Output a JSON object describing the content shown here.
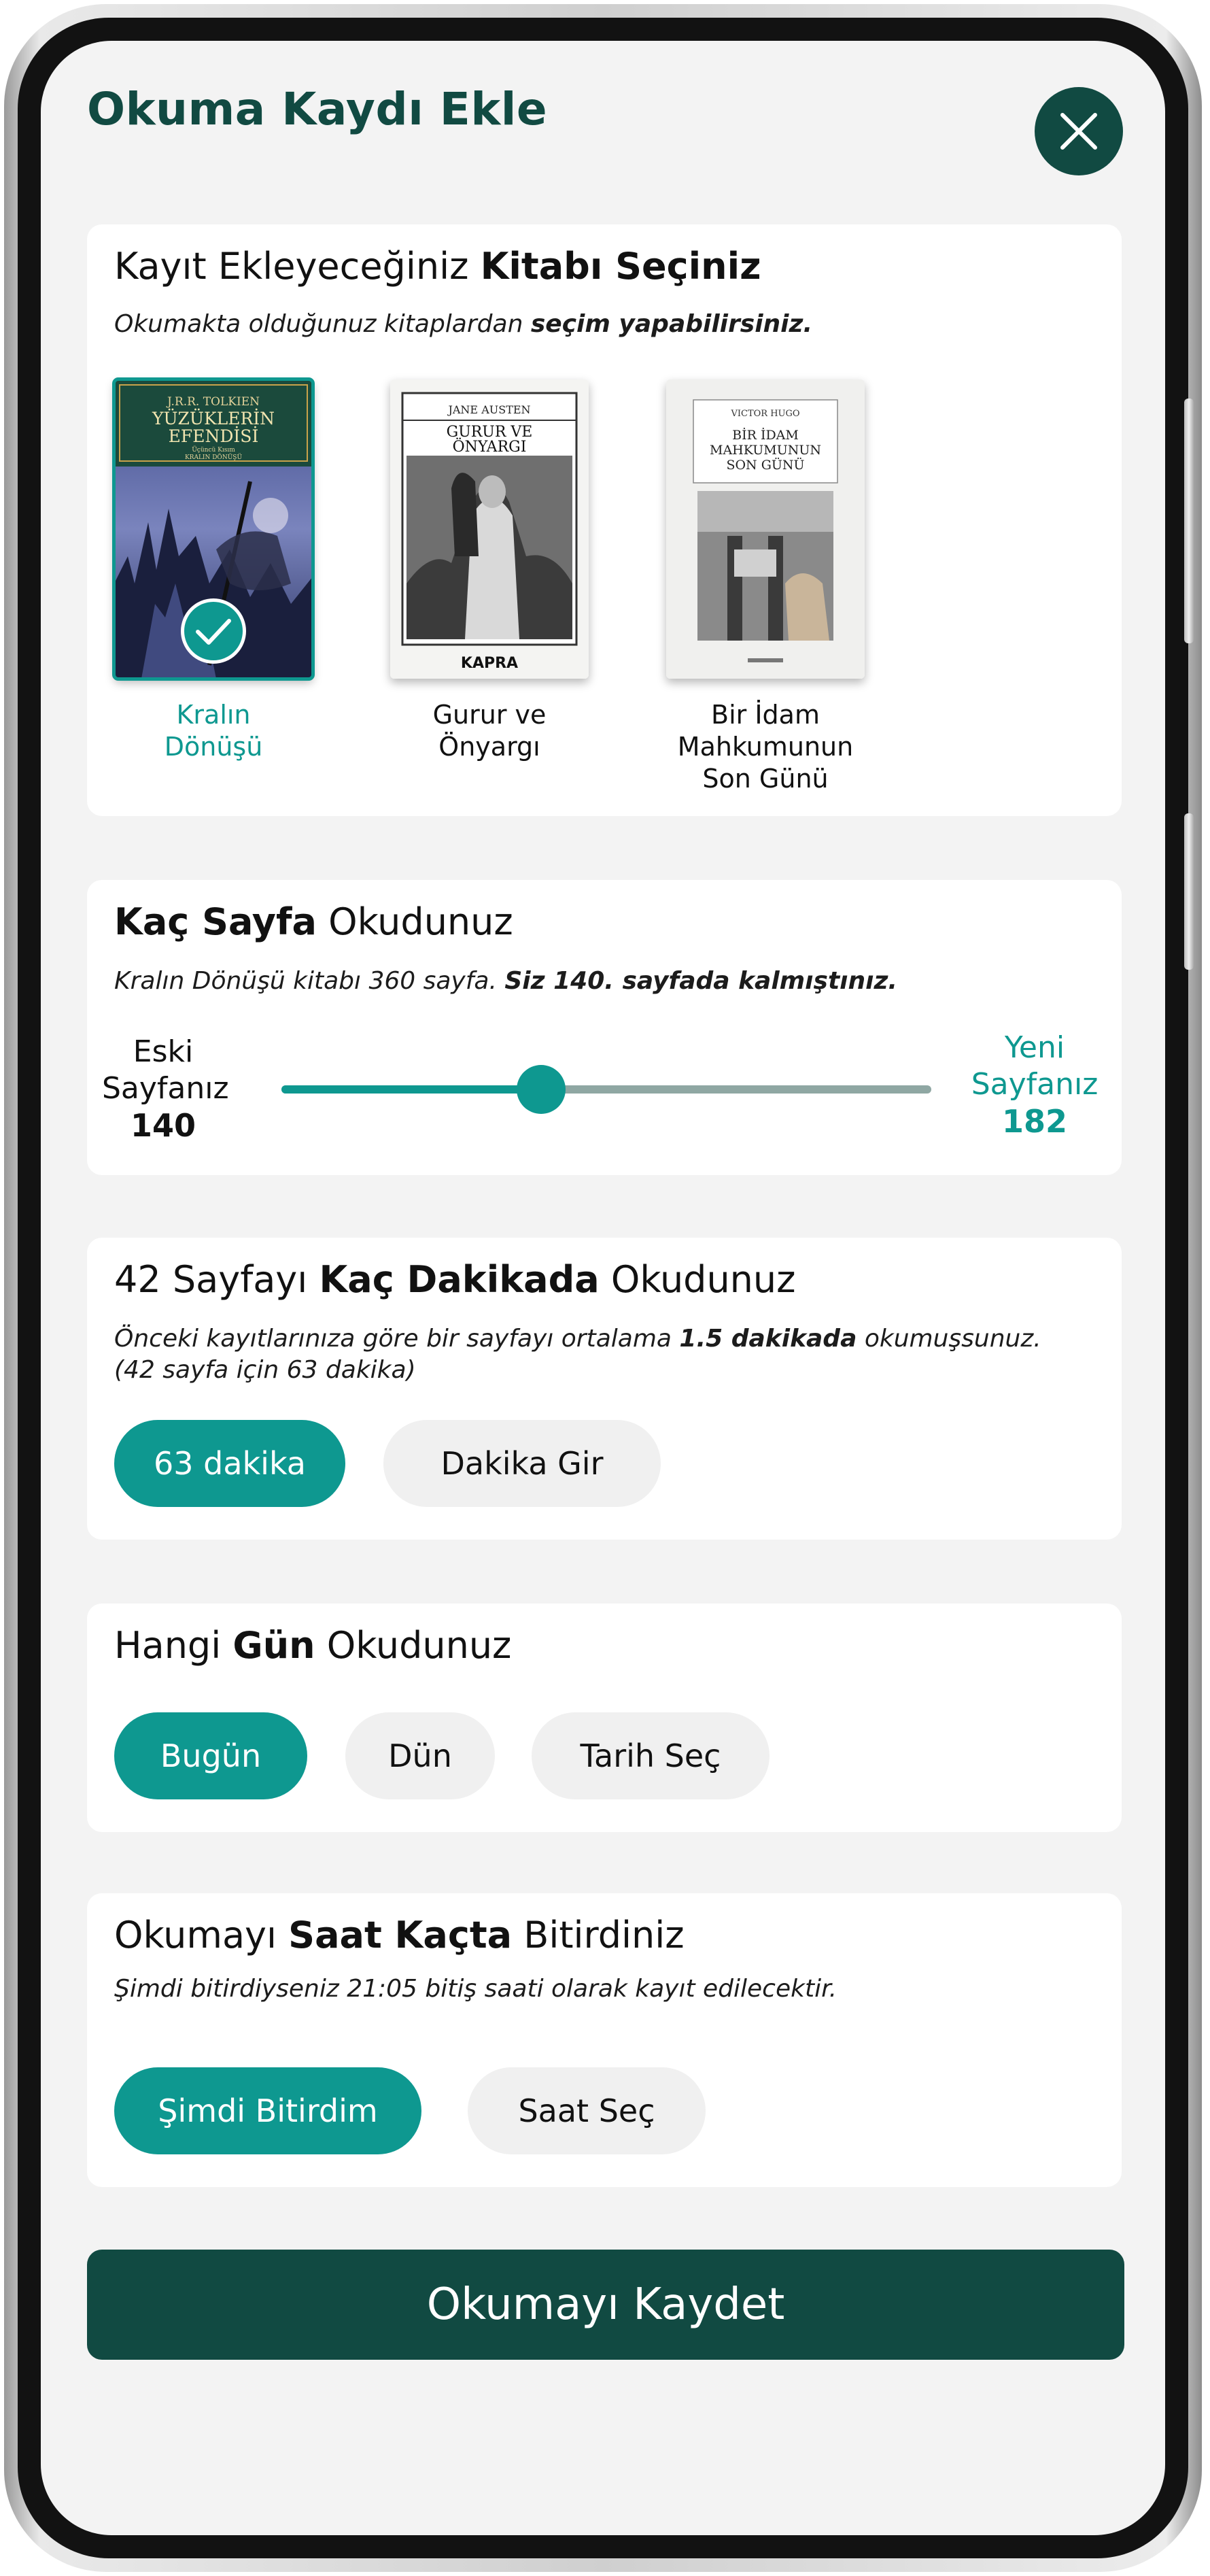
{
  "header": {
    "title": "Okuma Kaydı Ekle",
    "close_icon": "close-icon"
  },
  "book_section": {
    "title_normal": "Kayıt Ekleyeceğiniz ",
    "title_bold": "Kitabı Seçiniz",
    "sub_normal": "Okumakta olduğunuz kitaplardan ",
    "sub_bold": "seçim yapabilirsiniz.",
    "books": [
      {
        "label_line1": "Kralın",
        "label_line2": "Dönüşü",
        "label_line3": "",
        "cover_author": "J.R.R. TOLKIEN",
        "cover_title1": "YÜZÜKLERİN",
        "cover_title2": "EFENDİSİ",
        "cover_sub1": "Üçüncü Kısım",
        "cover_sub2": "KRALIN DÖNÜŞÜ",
        "selected": true
      },
      {
        "label_line1": "Gurur ve",
        "label_line2": "Önyargı",
        "label_line3": "",
        "cover_author": "JANE AUSTEN",
        "cover_title1": "GURUR VE",
        "cover_title2": "ÖNYARGI",
        "cover_publisher": "KAPRA",
        "selected": false
      },
      {
        "label_line1": "Bir İdam",
        "label_line2": "Mahkumunun",
        "label_line3": "Son Günü",
        "cover_author": "VICTOR HUGO",
        "cover_title1": "BİR İDAM",
        "cover_title2": "MAHKUMUNUN",
        "cover_title3": "SON GÜNÜ",
        "selected": false
      }
    ]
  },
  "pages_section": {
    "title_bold": "Kaç Sayfa",
    "title_normal": " Okudunuz",
    "sub_normal": "Kralın Dönüşü kitabı 360 sayfa. ",
    "sub_bold": "Siz 140. sayfada kalmıştınız.",
    "old_label_line1": "Eski",
    "old_label_line2": "Sayfanız",
    "old_page": "140",
    "new_label_line1": "Yeni",
    "new_label_line2": "Sayfanız",
    "new_page": "182",
    "slider_value_fraction": 0.4
  },
  "minutes_section": {
    "title_normal1": "42 Sayfayı ",
    "title_bold": "Kaç Dakikada",
    "title_normal2": " Okudunuz",
    "sub_line1_normal1": "Önceki kayıtlarınıza göre bir sayfayı ortalama ",
    "sub_line1_bold": "1.5 dakikada",
    "sub_line1_normal2": " okumuşsunuz.",
    "sub_line2": "(42 sayfa için 63 dakika)",
    "option_minutes": "63 dakika",
    "option_enter": "Dakika Gir"
  },
  "day_section": {
    "title_normal1": "Hangi ",
    "title_bold": "Gün",
    "title_normal2": " Okudunuz",
    "today": "Bugün",
    "yesterday": "Dün",
    "pick_date": "Tarih Seç"
  },
  "time_section": {
    "title_normal1": "Okumayı ",
    "title_bold": "Saat Kaçta",
    "title_normal2": " Bitirdiniz",
    "sub": "Şimdi bitirdiyseniz 21:05 bitiş saati olarak kayıt edilecektir.",
    "now": "Şimdi Bitirdim",
    "pick_time": "Saat Seç"
  },
  "save_label": "Okumayı Kaydet",
  "colors": {
    "primary_dark": "#114a42",
    "accent_teal": "#0e9890",
    "card_bg": "#ffffff",
    "screen_bg": "#f3f3f3"
  }
}
